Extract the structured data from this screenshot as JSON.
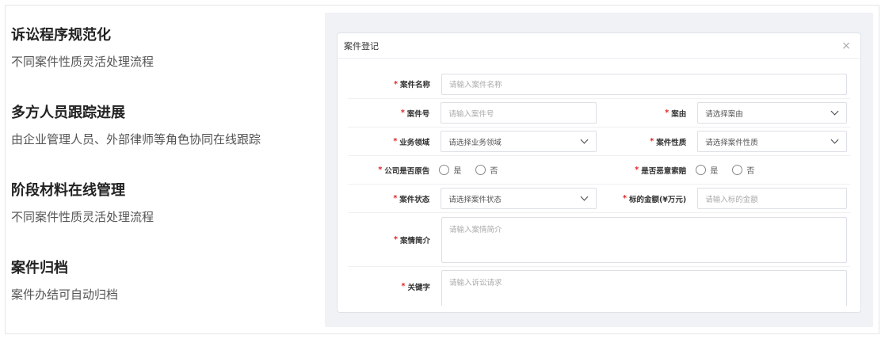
{
  "features": [
    {
      "title": "诉讼程序规范化",
      "desc": "不同案件性质灵活处理流程"
    },
    {
      "title": "多方人员跟踪进展",
      "desc": "由企业管理人员、外部律师等角色协同在线跟踪"
    },
    {
      "title": "阶段材料在线管理",
      "desc": "不同案件性质灵活处理流程"
    },
    {
      "title": "案件归档",
      "desc": "案件办结可自动归档"
    }
  ],
  "modal": {
    "title": "案件登记",
    "close": "×",
    "required_mark": "*",
    "fields": {
      "case_name": {
        "label": "案件名称",
        "placeholder": "请输入案件名称"
      },
      "case_no": {
        "label": "案件号",
        "placeholder": "请输入案件号"
      },
      "cause": {
        "label": "案由",
        "value": "请选择案由"
      },
      "business_area": {
        "label": "业务领域",
        "value": "请选择业务领域"
      },
      "case_nature": {
        "label": "案件性质",
        "value": "请选择案件性质"
      },
      "is_plaintiff": {
        "label": "公司是否原告",
        "yes": "是",
        "no": "否"
      },
      "malicious": {
        "label": "是否恶意索赔",
        "yes": "是",
        "no": "否"
      },
      "case_status": {
        "label": "案件状态",
        "value": "请选择案件状态"
      },
      "amount": {
        "label": "标的金额(¥万元)",
        "placeholder": "请输入标的金额"
      },
      "brief": {
        "label": "案情简介",
        "placeholder": "请输入案情简介"
      },
      "keywords": {
        "label": "关键字",
        "placeholder": "请输入诉讼请求"
      }
    }
  }
}
